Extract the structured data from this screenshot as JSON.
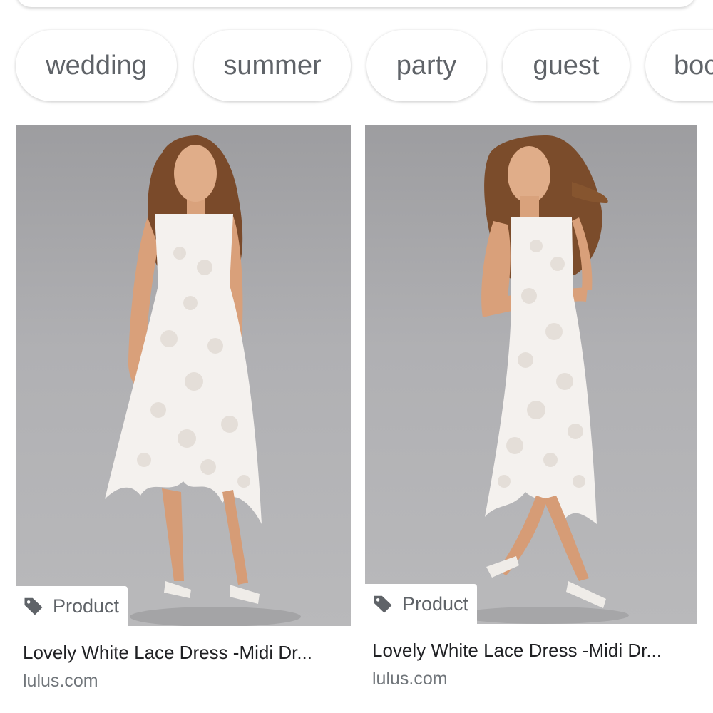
{
  "chips": [
    {
      "label": "wedding"
    },
    {
      "label": "summer"
    },
    {
      "label": "party"
    },
    {
      "label": "guest"
    },
    {
      "label": "boc"
    }
  ],
  "results": [
    {
      "badge": "Product",
      "title": "Lovely White Lace Dress -Midi Dr...",
      "domain": "lulus.com"
    },
    {
      "badge": "Product",
      "title": "Lovely White Lace Dress -Midi Dr...",
      "domain": "lulus.com"
    }
  ],
  "icons": {
    "badge_icon": "tag-icon"
  },
  "colors": {
    "chip_text": "#5f6368",
    "title_text": "#202124",
    "domain_text": "#70757a",
    "photo_background": "#ababae"
  }
}
